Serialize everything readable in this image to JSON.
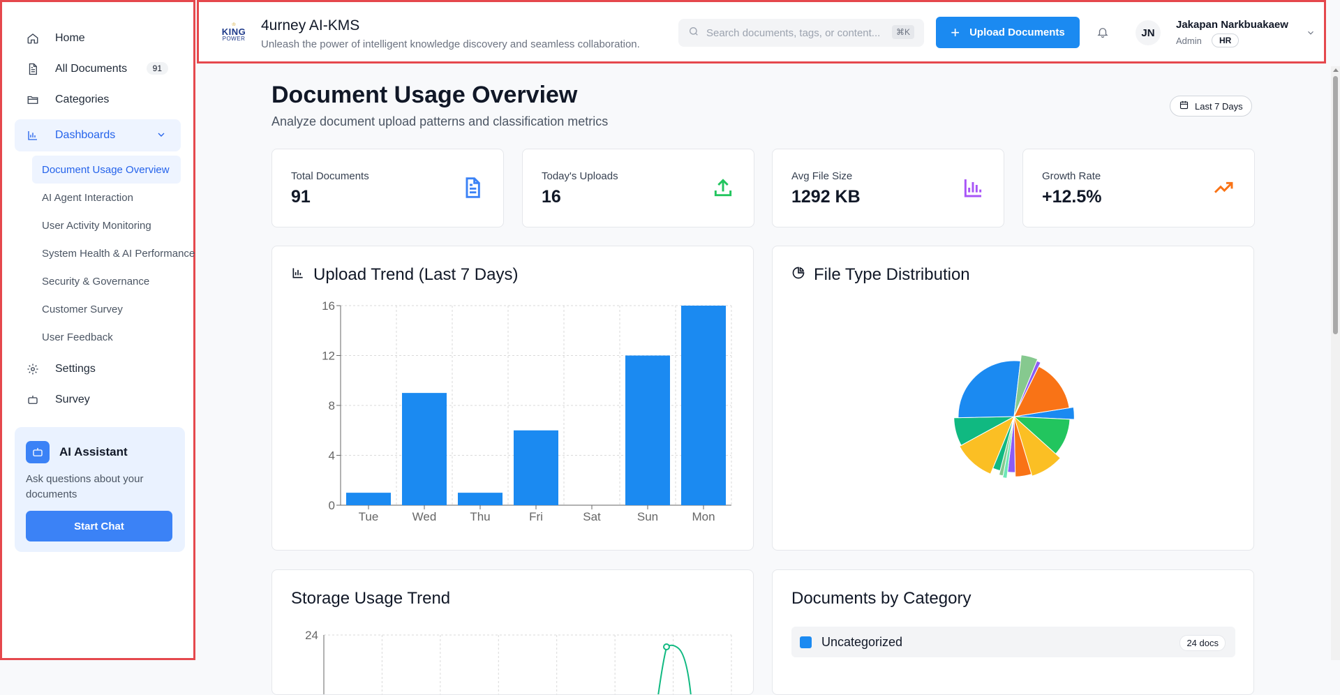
{
  "sidebar": {
    "nav": [
      {
        "label": "Home",
        "icon": "home-icon"
      },
      {
        "label": "All Documents",
        "icon": "document-icon",
        "count": "91"
      },
      {
        "label": "Categories",
        "icon": "folder-icon"
      }
    ],
    "dashboards": {
      "label": "Dashboards",
      "icon": "bar-chart-icon",
      "items": [
        {
          "label": "Document Usage Overview",
          "active": true
        },
        {
          "label": "AI Agent Interaction"
        },
        {
          "label": "User Activity Monitoring"
        },
        {
          "label": "System Health & AI Performance"
        },
        {
          "label": "Security & Governance"
        },
        {
          "label": "Customer Survey"
        },
        {
          "label": "User Feedback"
        }
      ]
    },
    "nav_bottom": [
      {
        "label": "Settings",
        "icon": "gear-icon"
      },
      {
        "label": "Survey",
        "icon": "bot-icon"
      }
    ],
    "ai_card": {
      "title": "AI Assistant",
      "description": "Ask questions about your documents",
      "button": "Start Chat"
    }
  },
  "header": {
    "logo": {
      "crown": "♔",
      "line1": "KING",
      "line2": "POWER"
    },
    "title": "4urney AI-KMS",
    "tagline": "Unleash the power of intelligent knowledge discovery and seamless collaboration.",
    "search_placeholder": "Search documents, tags, or content...",
    "search_shortcut": "⌘K",
    "upload_label": "Upload Documents",
    "user": {
      "initials": "JN",
      "name": "Jakapan Narkbuakaew",
      "role": "Admin",
      "dept": "HR"
    }
  },
  "main": {
    "title": "Document Usage Overview",
    "subtitle": "Analyze document upload patterns and classification metrics",
    "range": "Last 7 Days",
    "stats": [
      {
        "label": "Total Documents",
        "value": "91",
        "icon": "document-icon",
        "color": "#3b82f6"
      },
      {
        "label": "Today's Uploads",
        "value": "16",
        "icon": "upload-icon",
        "color": "#22c55e"
      },
      {
        "label": "Avg File Size",
        "value": "1292 KB",
        "icon": "bar-chart-icon",
        "color": "#a855f7"
      },
      {
        "label": "Growth Rate",
        "value": "+12.5%",
        "icon": "trending-up-icon",
        "color": "#f97316"
      }
    ],
    "upload_trend_title": "Upload Trend (Last 7 Days)",
    "file_type_title": "File Type Distribution",
    "storage_title": "Storage Usage Trend",
    "category_title": "Documents by Category",
    "categories": [
      {
        "name": "Uncategorized",
        "count": "24 docs",
        "color": "#1b8af1"
      }
    ]
  },
  "chart_data": [
    {
      "type": "bar",
      "title": "Upload Trend (Last 7 Days)",
      "categories": [
        "Tue",
        "Wed",
        "Thu",
        "Fri",
        "Sat",
        "Sun",
        "Mon"
      ],
      "values": [
        1,
        9,
        1,
        6,
        0,
        12,
        16
      ],
      "yticks": [
        0,
        4,
        8,
        12,
        16
      ],
      "ylim": [
        0,
        16
      ],
      "grid": true,
      "color": "#1b8af1"
    },
    {
      "type": "pie",
      "title": "File Type Distribution",
      "values": [
        3,
        10,
        8,
        4,
        2,
        1,
        1,
        2,
        10,
        7,
        25,
        4,
        1,
        14
      ],
      "colors": [
        "#1b8af1",
        "#22c55e",
        "#fbbf24",
        "#f97316",
        "#8b5cf6",
        "#6ee7b7",
        "#86c98f",
        "#10b981",
        "#fbbf24",
        "#10b981",
        "#1b8af1",
        "#86c98f",
        "#8b5cf6",
        "#f97316"
      ]
    },
    {
      "type": "line",
      "title": "Storage Usage Trend",
      "ylim_top_tick": 24,
      "yticks": [
        24
      ],
      "color": "#10b981"
    }
  ]
}
